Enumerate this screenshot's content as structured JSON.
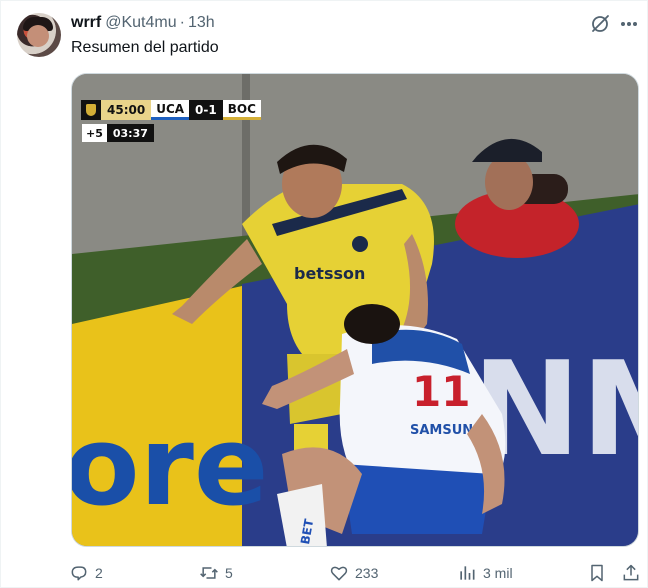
{
  "author": {
    "name": "wrrf",
    "handle": "@Kut4mu",
    "separator": "·",
    "time": "13h"
  },
  "tweet": {
    "text": "Resumen del partido"
  },
  "media": {
    "scoreboard": {
      "clock": "45:00",
      "home_team": "UCA",
      "score": "0-1",
      "away_team": "BOC",
      "added_time": "+5",
      "added_clock": "03:37"
    },
    "ad_board_left": "ore",
    "ad_board_right": "NM",
    "jersey_sponsor": "betsson",
    "jersey_number": "11",
    "shirt_sponsor_white": "SAMSUNG",
    "sock_text": "BET"
  },
  "actions": {
    "replies": "2",
    "retweets": "5",
    "likes": "233",
    "views": "3 mil"
  },
  "colors": {
    "text": "#0f1419",
    "secondary": "#536471",
    "boca_yellow": "#e8d43a",
    "boca_navy": "#1b2a4a"
  }
}
